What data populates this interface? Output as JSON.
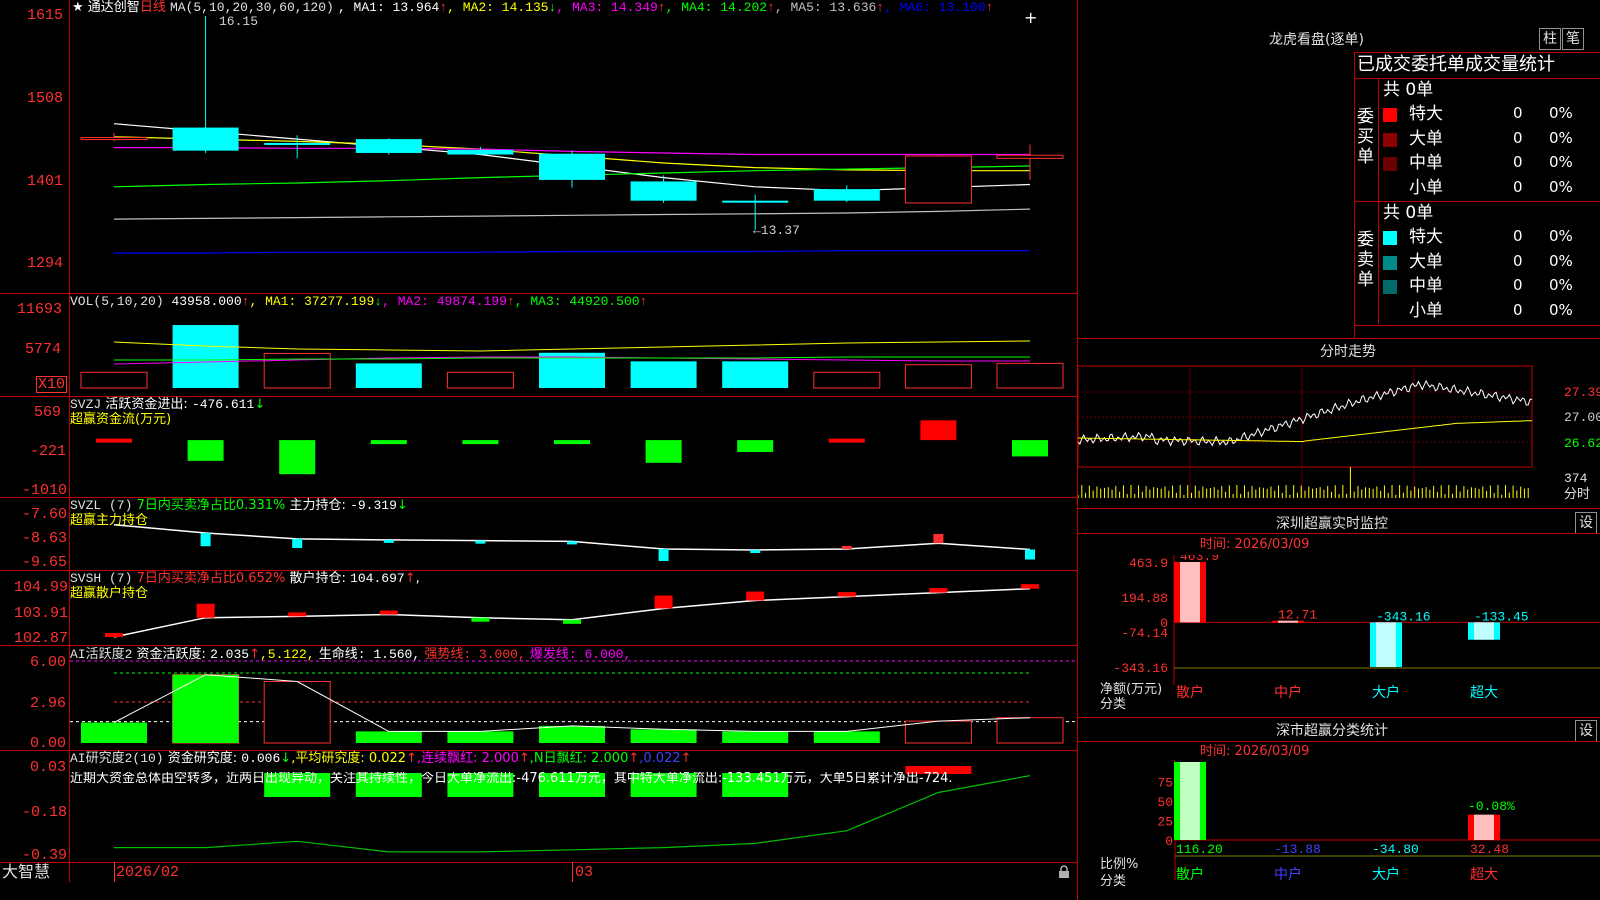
{
  "window": {
    "brand": "大智慧",
    "close_glyph": "+"
  },
  "main_panel": {
    "star": "★",
    "stock": "通达创智",
    "period": "日线",
    "ma_title": "MA(5,10,20,30,60,120)",
    "ma": [
      {
        "label": "MA1:",
        "value": "13.964",
        "arrow": "↑",
        "color": "#ffffff"
      },
      {
        "label": "MA2:",
        "value": "14.135",
        "arrow": "↓",
        "color": "#ffff00"
      },
      {
        "label": "MA3:",
        "value": "14.349",
        "arrow": "↑",
        "color": "#ff00ff"
      },
      {
        "label": "MA4:",
        "value": "14.202",
        "arrow": "↑",
        "color": "#00ff00"
      },
      {
        "label": "MA5:",
        "value": "13.636",
        "arrow": "↑",
        "color": "#c0c0c0"
      },
      {
        "label": "MA6:",
        "value": "13.100",
        "arrow": "↑",
        "color": "#0000ff"
      }
    ],
    "y_ticks": [
      "1615",
      "1508",
      "1401",
      "1294"
    ],
    "high_label": "16.15",
    "low_label": "←13.37"
  },
  "vol_panel": {
    "title": "VOL(5,10,20)",
    "value": "43958.000",
    "arrow": "↑",
    "ma": [
      {
        "label": "MA1:",
        "value": "37277.199",
        "arrow": "↓",
        "color": "#ffff00"
      },
      {
        "label": "MA2:",
        "value": "49874.199",
        "arrow": "↑",
        "color": "#ff00ff"
      },
      {
        "label": "MA3:",
        "value": "44920.500",
        "arrow": "↑",
        "color": "#00ff00"
      }
    ],
    "y_ticks": [
      "11693",
      "5774"
    ],
    "unit": "X10"
  },
  "svzj_panel": {
    "title": "SVZJ",
    "label": "活跃资金进出:",
    "value": "-476.611",
    "arrow": "↓",
    "name": "超赢资金流(万元)",
    "y_ticks": [
      "569",
      "-221",
      "-1010"
    ]
  },
  "svzl_panel": {
    "title": "SVZL (7)",
    "ratio": "7日内买卖净占比0.331%",
    "label": "主力持仓:",
    "value": "-9.319",
    "arrow": "↓",
    "name": "超赢主力持仓",
    "y_ticks": [
      "-7.60",
      "-8.63",
      "-9.65"
    ]
  },
  "svsh_panel": {
    "title": "SVSH (7)",
    "ratio": "7日内买卖净占比0.652%",
    "label": "散户持仓:",
    "value": "104.697",
    "arrow": "↑",
    "tail": ",",
    "name": "超赢散户持仓",
    "y_ticks": [
      "104.99",
      "103.91",
      "102.87"
    ]
  },
  "ai_active_panel": {
    "title": "AI活跃度2",
    "label": "资金活跃度:",
    "value": "2.035",
    "arrow": "↑",
    "value2": ",5.122,",
    "life": "生命线: 1.560,",
    "strong": "强势线: 3.000,",
    "burst": "爆发线: 6.000,",
    "y_ticks": [
      "6.00",
      "2.96",
      "0.00"
    ]
  },
  "ai_research_panel": {
    "title": "AI研究度2(10)",
    "label": "资金研究度:",
    "value": "0.006",
    "arrow": "↓",
    "avg": ",平均研究度: 0.022",
    "avg_arrow": "↑",
    "red": ",连续飘红: 2.000",
    "red_arrow": "↑",
    "nred": ",N日飘红: 2.000",
    "nred_arrow": "↑",
    "last": ",0.022",
    "last_arrow": "↑",
    "commentary": "近期大资金总体由空转多，近两日出现异动，关注其持续性，今日大单净流出:-476.611万元，其中特大单净流出:-133.451万元，大单5日累计净出-724.",
    "y_ticks": [
      "0.03",
      "-0.18",
      "-0.39"
    ]
  },
  "x_axis": {
    "labels": [
      "2026/02",
      "03"
    ]
  },
  "dragon_panel": {
    "title": "龙虎看盘(逐单)",
    "btn_column": "柱",
    "btn_stroke": "笔",
    "header": "已成交委托单成交量统计",
    "buy": {
      "side": [
        "委",
        "买",
        "单"
      ],
      "total": "共 0单",
      "rows": [
        {
          "name": "特大",
          "count": "0",
          "pct": "0%",
          "color": "#ff0000"
        },
        {
          "name": "大单",
          "count": "0",
          "pct": "0%",
          "color": "#8b0000"
        },
        {
          "name": "中单",
          "count": "0",
          "pct": "0%",
          "color": "#6a0000"
        },
        {
          "name": "小单",
          "count": "0",
          "pct": "0%",
          "color": ""
        }
      ]
    },
    "sell": {
      "side": [
        "委",
        "卖",
        "单"
      ],
      "total": "共 0单",
      "rows": [
        {
          "name": "特大",
          "count": "0",
          "pct": "0%",
          "color": "#00ffff"
        },
        {
          "name": "大单",
          "count": "0",
          "pct": "0%",
          "color": "#008b8b"
        },
        {
          "name": "中单",
          "count": "0",
          "pct": "0%",
          "color": "#006a6a"
        },
        {
          "name": "小单",
          "count": "0",
          "pct": "0%",
          "color": ""
        }
      ]
    }
  },
  "intraday_panel": {
    "title": "分时走势",
    "y_ticks": [
      "27.39",
      "27.00",
      "26.62"
    ],
    "vol_tick": "374",
    "vol_label": "分时"
  },
  "monitor_panel": {
    "title": "深圳超赢实时监控",
    "settings": "设",
    "date_label": "时间: 2026/03/09",
    "y_ticks": [
      "463.9",
      "194.88",
      "0",
      "-74.14",
      "-343.16"
    ],
    "y_caption": "净额(万元)",
    "x_caption": "分类",
    "categories": [
      "散户",
      "中户",
      "大户",
      "超大"
    ],
    "values": [
      "463.9",
      "12.71",
      "-343.16",
      "-133.45"
    ]
  },
  "classify_panel": {
    "title": "深市超赢分类统计",
    "settings": "设",
    "date_label": "时间: 2026/03/09",
    "y_ticks": [
      "75",
      "50",
      "25",
      "0"
    ],
    "y_caption": "比例%",
    "x_caption": "分类",
    "categories": [
      "散户",
      "中户",
      "大户",
      "超大"
    ],
    "values": [
      "116.20",
      "-13.88",
      "-34.80",
      "32.48"
    ],
    "bar_label": "-0.08%"
  },
  "chart_data": [
    {
      "type": "candlestick",
      "title": "通达创智 日线",
      "categories": [
        "1",
        "2",
        "3",
        "4",
        "5",
        "6",
        "7",
        "8",
        "9",
        "10",
        "11"
      ],
      "ohlc": [
        [
          14.55,
          14.63,
          14.52,
          14.57
        ],
        [
          14.7,
          16.15,
          14.37,
          14.4
        ],
        [
          14.5,
          14.6,
          14.3,
          14.48
        ],
        [
          14.55,
          14.56,
          14.35,
          14.37
        ],
        [
          14.41,
          14.45,
          14.34,
          14.35
        ],
        [
          14.36,
          14.4,
          13.92,
          14.02
        ],
        [
          14.0,
          14.08,
          13.72,
          13.75
        ],
        [
          13.75,
          13.83,
          13.37,
          13.74
        ],
        [
          13.9,
          13.95,
          13.73,
          13.75
        ],
        [
          13.72,
          14.35,
          13.72,
          14.33
        ],
        [
          14.3,
          14.48,
          14.02,
          14.34
        ]
      ],
      "ma_series": [
        {
          "name": "MA1",
          "values": [
            14.75,
            14.65,
            14.55,
            14.45,
            14.35,
            14.2,
            14.05,
            13.93,
            13.88,
            13.92,
            13.96
          ]
        },
        {
          "name": "MA2",
          "values": [
            14.58,
            14.55,
            14.52,
            14.48,
            14.42,
            14.33,
            14.24,
            14.18,
            14.15,
            14.14,
            14.14
          ]
        },
        {
          "name": "MA3",
          "values": [
            14.44,
            14.44,
            14.43,
            14.43,
            14.42,
            14.39,
            14.37,
            14.35,
            14.35,
            14.35,
            14.35
          ]
        },
        {
          "name": "MA4",
          "values": [
            13.93,
            13.96,
            13.98,
            14.01,
            14.05,
            14.08,
            14.11,
            14.14,
            14.16,
            14.18,
            14.2
          ]
        },
        {
          "name": "MA5",
          "values": [
            13.51,
            13.52,
            13.53,
            13.54,
            13.55,
            13.56,
            13.57,
            13.58,
            13.59,
            13.61,
            13.64
          ]
        },
        {
          "name": "MA6",
          "values": [
            13.07,
            13.07,
            13.08,
            13.08,
            13.08,
            13.09,
            13.09,
            13.09,
            13.1,
            13.1,
            13.1
          ]
        }
      ],
      "y_ticks": [
        16.15,
        15.08,
        14.01,
        12.94
      ]
    },
    {
      "type": "bar",
      "title": "VOL(5,10,20)",
      "values": [
        2300,
        9200,
        5050,
        3600,
        2300,
        5150,
        3900,
        3900,
        2300,
        3400,
        3600
      ],
      "colors": [
        "red",
        "cyan",
        "red",
        "cyan",
        "red",
        "cyan",
        "cyan",
        "cyan",
        "red",
        "red",
        "red"
      ],
      "hollow": [
        true,
        false,
        true,
        false,
        true,
        false,
        false,
        false,
        true,
        true,
        true
      ],
      "ylim": [
        0,
        11693
      ]
    },
    {
      "type": "bar",
      "title": "SVZJ 超赢资金流(万元)",
      "values": [
        30,
        -420,
        -690,
        -40,
        -70,
        -30,
        -460,
        -240,
        30,
        400,
        -330
      ],
      "ylim": [
        -1010,
        569
      ]
    },
    {
      "type": "line",
      "title": "SVZL 超赢主力持仓",
      "values": [
        -8.02,
        -8.35,
        -8.58,
        -8.62,
        -8.65,
        -8.68,
        -8.98,
        -9.02,
        -8.98,
        -8.75,
        -9.0
      ],
      "ylim": [
        -9.65,
        -7.6
      ]
    },
    {
      "type": "line",
      "title": "SVSH 超赢散户持仓",
      "values": [
        102.87,
        103.6,
        103.65,
        103.72,
        103.6,
        103.52,
        103.95,
        104.25,
        104.4,
        104.55,
        104.7
      ],
      "ylim": [
        102.87,
        104.99
      ]
    },
    {
      "type": "bar",
      "title": "AI活跃度2",
      "values": [
        1.5,
        5.0,
        4.5,
        0.85,
        0.85,
        1.25,
        1.0,
        0.85,
        0.85,
        1.6,
        1.85
      ],
      "ylim": [
        0,
        6
      ]
    },
    {
      "type": "line",
      "title": "AI研究度2(10)",
      "values": [
        -0.36,
        -0.36,
        -0.33,
        -0.38,
        -0.38,
        -0.37,
        -0.36,
        -0.34,
        -0.28,
        -0.1,
        -0.02
      ],
      "ylim": [
        -0.39,
        0.03
      ]
    },
    {
      "type": "bar",
      "title": "深圳超赢实时监控",
      "categories": [
        "散户",
        "中户",
        "大户",
        "超大"
      ],
      "values": [
        463.9,
        12.71,
        -343.16,
        -133.45
      ]
    },
    {
      "type": "bar",
      "title": "深市超赢分类统计",
      "categories": [
        "散户",
        "中户",
        "大户",
        "超大"
      ],
      "values": [
        116.2,
        -13.88,
        -34.8,
        32.48
      ]
    }
  ]
}
